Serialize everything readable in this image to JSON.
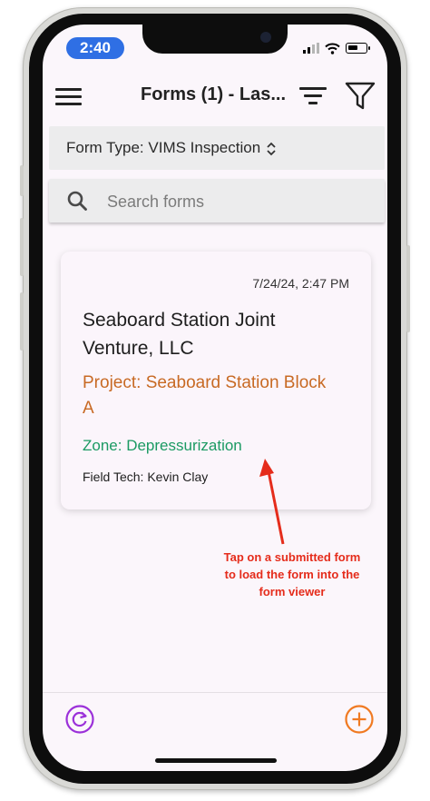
{
  "status_bar": {
    "time": "2:40"
  },
  "header": {
    "title": "Forms (1) - Las..."
  },
  "form_type": {
    "label": "Form Type: VIMS Inspection"
  },
  "search": {
    "placeholder": "Search forms"
  },
  "form_card": {
    "date": "7/24/24, 2:47 PM",
    "company": "Seaboard Station Joint Venture, LLC",
    "project": "Project: Seaboard Station Block A",
    "zone": "Zone: Depressurization",
    "field_tech": "Field Tech: Kevin Clay"
  },
  "annotation": {
    "lines": [
      "Tap on a submitted form",
      "to load the form into the",
      "form viewer"
    ]
  },
  "colors": {
    "time_pill": "#2f6fe4",
    "project_text": "#c86a24",
    "zone_text": "#1b9a63",
    "annotation": "#e52c1b",
    "refresh_icon": "#9b30d9",
    "add_icon": "#f07a22"
  },
  "icons": {
    "menu": "hamburger-menu-icon",
    "sort": "sort-lines-icon",
    "filter": "funnel-filter-icon",
    "form_type_toggle": "chevron-up-down-icon",
    "search": "magnifier-icon",
    "refresh": "refresh-circle-icon",
    "add": "plus-circle-icon"
  }
}
